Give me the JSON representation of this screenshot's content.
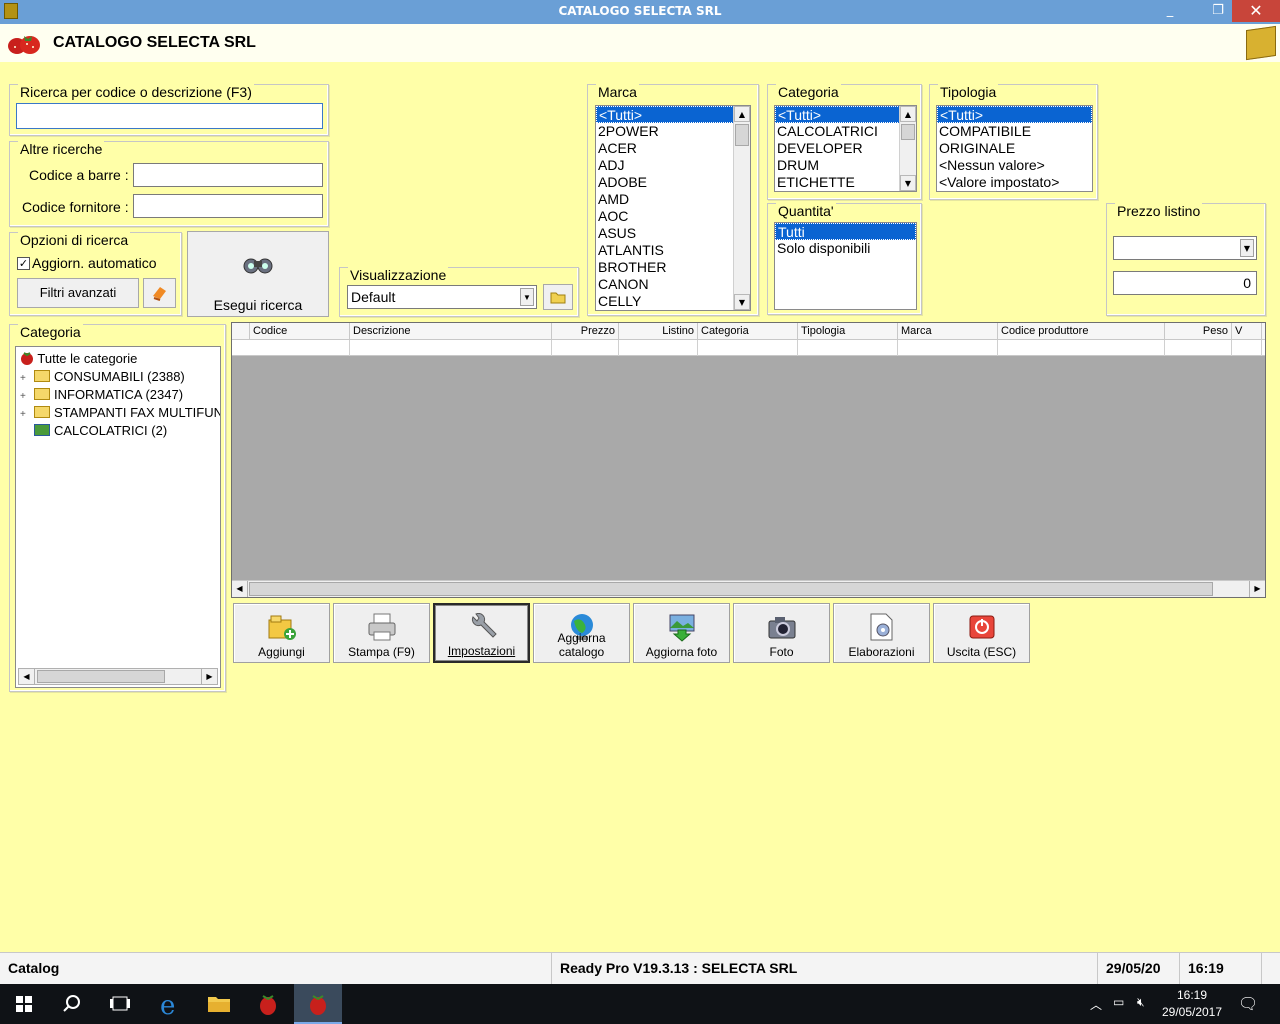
{
  "window": {
    "title": "CATALOGO SELECTA SRL",
    "minimize": "_",
    "restore": "❐",
    "close": "✕"
  },
  "header": {
    "title": "CATALOGO SELECTA SRL"
  },
  "search": {
    "title": "Ricerca per codice o descrizione (F3)",
    "value": ""
  },
  "other_search": {
    "title": "Altre ricerche",
    "barcode_label": "Codice a barre :",
    "barcode_value": "",
    "supplier_label": "Codice fornitore :",
    "supplier_value": ""
  },
  "search_options": {
    "title": "Opzioni di ricerca",
    "auto_update_label": "Aggiorn. automatico",
    "auto_update_checked": true,
    "advanced_filters": "Filtri avanzati"
  },
  "run_search": {
    "label": "Esegui ricerca"
  },
  "view": {
    "title": "Visualizzazione",
    "selected": "Default"
  },
  "brand": {
    "title": "Marca",
    "items": [
      "<Tutti>",
      "2POWER",
      "ACER",
      "ADJ",
      "ADOBE",
      "AMD",
      "AOC",
      "ASUS",
      "ATLANTIS",
      "BROTHER",
      "CANON",
      "CELLY"
    ],
    "selected_index": 0
  },
  "category_filter": {
    "title": "Categoria",
    "items": [
      "<Tutti>",
      "CALCOLATRICI",
      "DEVELOPER",
      "DRUM",
      "ETICHETTE"
    ],
    "selected_index": 0
  },
  "type_filter": {
    "title": "Tipologia",
    "items": [
      "<Tutti>",
      "COMPATIBILE",
      "ORIGINALE",
      "<Nessun valore>",
      "<Valore impostato>"
    ],
    "selected_index": 0
  },
  "quantity": {
    "title": "Quantita'",
    "items": [
      "Tutti",
      "Solo disponibili"
    ],
    "selected_index": 0
  },
  "price_list": {
    "title": "Prezzo listino",
    "selected": "",
    "value": "0"
  },
  "tree": {
    "title": "Categoria",
    "root": "Tutte le categorie",
    "nodes": [
      {
        "label": "CONSUMABILI (2388)",
        "expander": "+"
      },
      {
        "label": "INFORMATICA (2347)",
        "expander": "+"
      },
      {
        "label": "STAMPANTI FAX MULTIFUNZ",
        "expander": "+"
      },
      {
        "label": "CALCOLATRICI (2)",
        "expander": ""
      }
    ]
  },
  "grid": {
    "columns": [
      "Codice",
      "Descrizione",
      "Prezzo",
      "Listino",
      "Categoria",
      "Tipologia",
      "Marca",
      "Codice produttore",
      "Peso",
      "V"
    ],
    "rows": []
  },
  "toolbar": {
    "buttons": [
      {
        "label": "Aggiungi",
        "icon": "add-folder-icon"
      },
      {
        "label": "Stampa (F9)",
        "icon": "printer-icon"
      },
      {
        "label": "Impostazioni",
        "icon": "wrench-icon"
      },
      {
        "label": "Aggiorna catalogo",
        "icon": "globe-icon"
      },
      {
        "label": "Aggiorna foto",
        "icon": "photo-download-icon"
      },
      {
        "label": "Foto",
        "icon": "camera-icon"
      },
      {
        "label": "Elaborazioni",
        "icon": "document-gear-icon"
      },
      {
        "label": "Uscita (ESC)",
        "icon": "power-icon"
      }
    ]
  },
  "status": {
    "module": "Catalog",
    "version": "Ready Pro V19.3.13 : SELECTA SRL",
    "date": "29/05/20",
    "time": "16:19"
  },
  "taskbar": {
    "clock_time": "16:19",
    "clock_date": "29/05/2017"
  },
  "colors": {
    "background": "#ffffa8",
    "titlebar": "#6a9fd6",
    "selection": "#0a64d2",
    "grid_empty": "#a9a9a9"
  }
}
